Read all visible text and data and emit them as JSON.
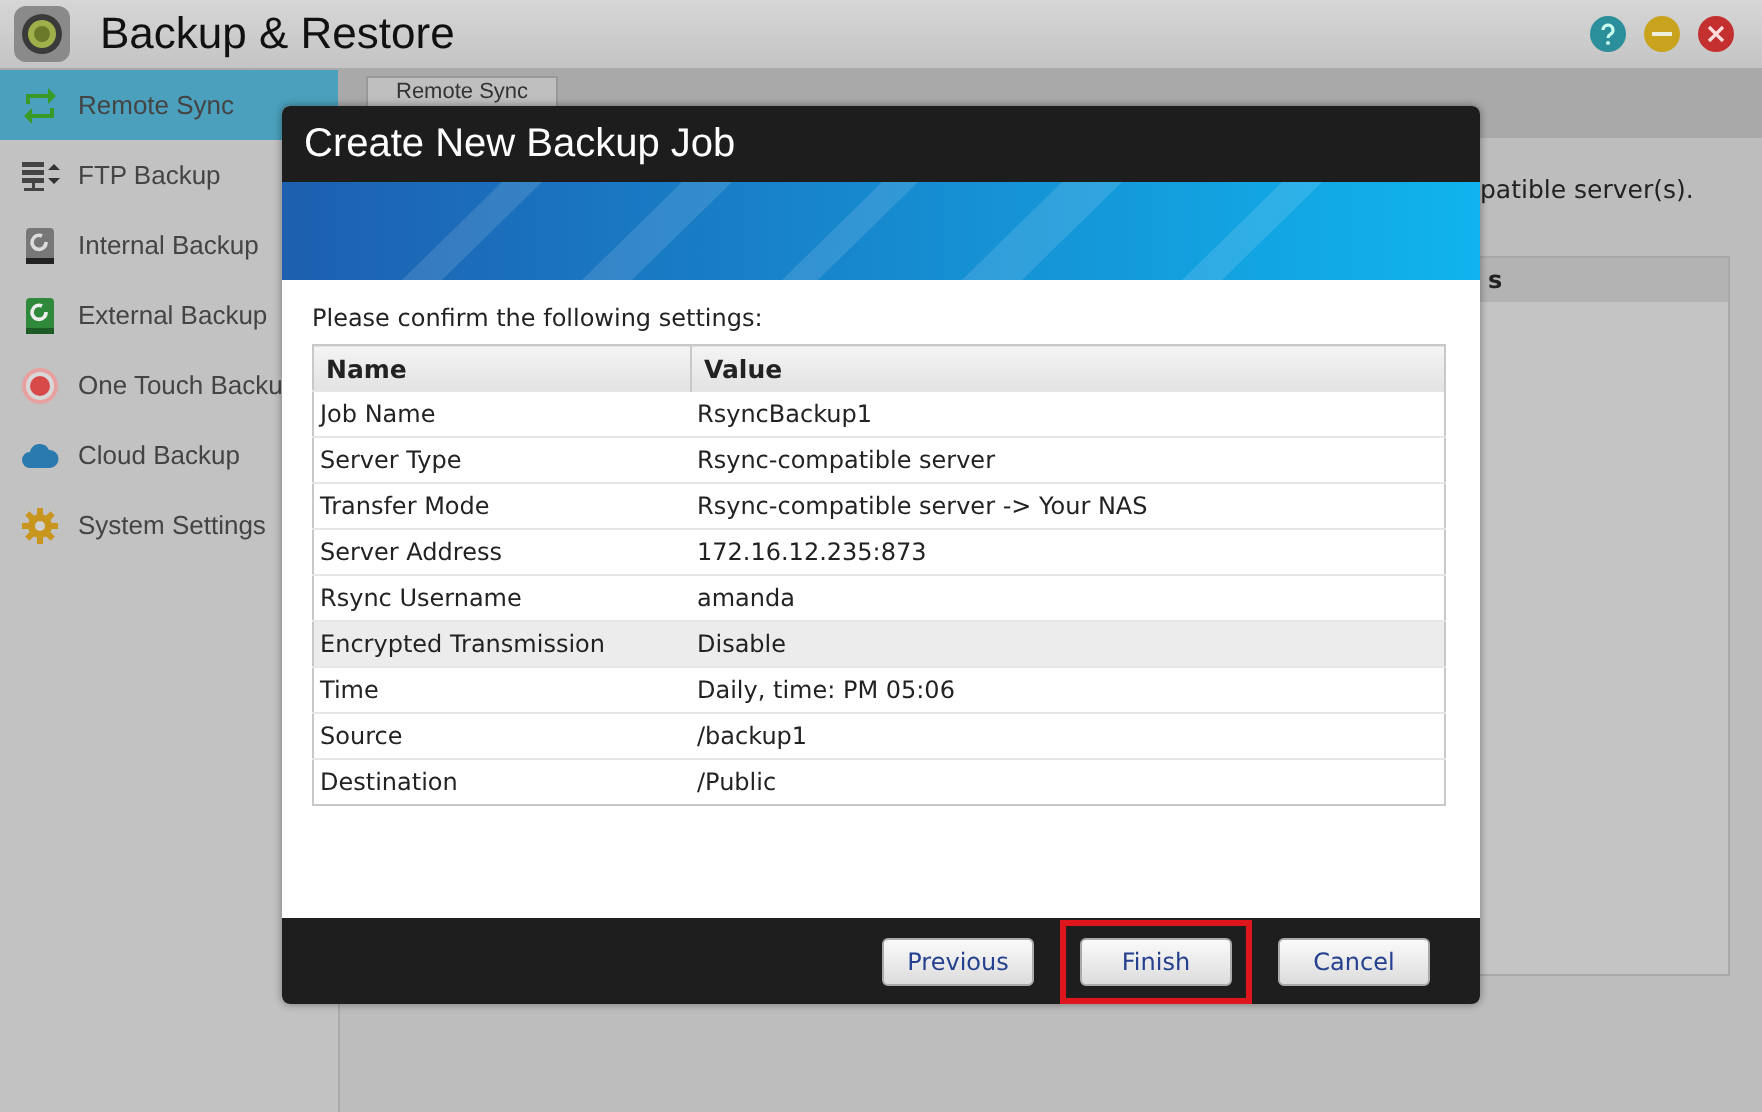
{
  "window": {
    "title": "Backup & Restore"
  },
  "sidebar": {
    "items": [
      {
        "label": "Remote Sync",
        "selected": true
      },
      {
        "label": "FTP Backup",
        "selected": false
      },
      {
        "label": "Internal Backup",
        "selected": false
      },
      {
        "label": "External Backup",
        "selected": false
      },
      {
        "label": "One Touch Backu",
        "selected": false
      },
      {
        "label": "Cloud Backup",
        "selected": false
      },
      {
        "label": "System Settings",
        "selected": false
      }
    ]
  },
  "main": {
    "tab": "Remote Sync",
    "description": "patible server(s).",
    "table_header": "s"
  },
  "dialog": {
    "title": "Create New Backup Job",
    "prompt": "Please confirm the following settings:",
    "columns": [
      "Name",
      "Value"
    ],
    "rows": [
      {
        "name": "Job Name",
        "value": "RsyncBackup1",
        "selected": false
      },
      {
        "name": "Server Type",
        "value": "Rsync-compatible server",
        "selected": false
      },
      {
        "name": "Transfer Mode",
        "value": "Rsync-compatible server -> Your NAS",
        "selected": false
      },
      {
        "name": "Server Address",
        "value": "172.16.12.235:873",
        "selected": false
      },
      {
        "name": "Rsync Username",
        "value": "amanda",
        "selected": false
      },
      {
        "name": "Encrypted Transmission",
        "value": "Disable",
        "selected": true
      },
      {
        "name": "Time",
        "value": "Daily, time: PM 05:06",
        "selected": false
      },
      {
        "name": "Source",
        "value": "/backup1",
        "selected": false
      },
      {
        "name": "Destination",
        "value": "/Public",
        "selected": false
      }
    ],
    "buttons": [
      {
        "label": "Previous",
        "highlighted": false
      },
      {
        "label": "Finish",
        "highlighted": true
      },
      {
        "label": "Cancel",
        "highlighted": false
      }
    ]
  }
}
